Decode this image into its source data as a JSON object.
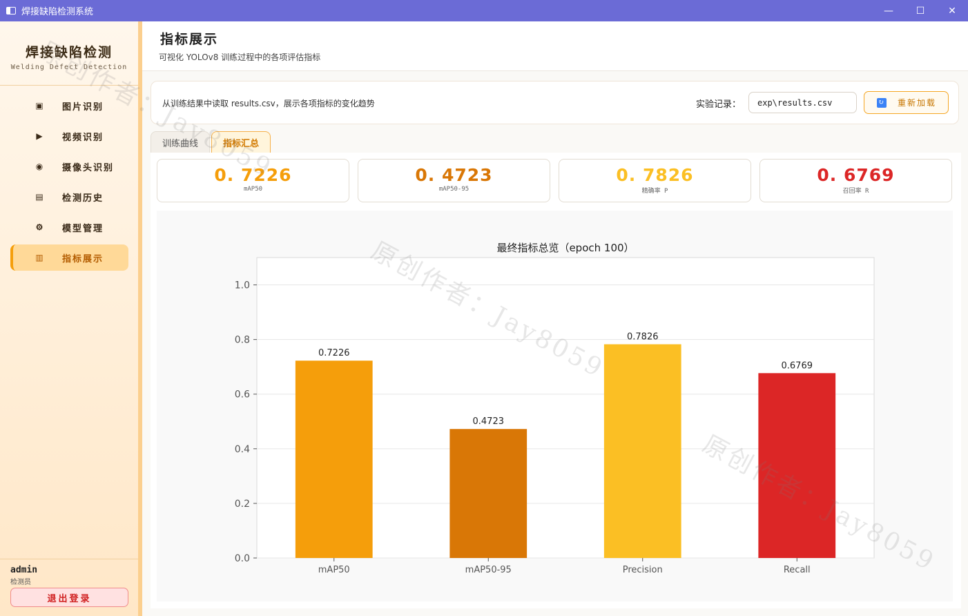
{
  "window": {
    "title": "焊接缺陷检测系统",
    "controls": {
      "minimize": "—",
      "maximize": "☐",
      "close": "✕"
    }
  },
  "sidebar": {
    "brand_title": "焊接缺陷检测",
    "brand_subtitle": "Welding Defect Detection",
    "items": [
      {
        "label": "图片识别",
        "icon": "image-icon",
        "glyph": "▣"
      },
      {
        "label": "视频识别",
        "icon": "video-icon",
        "glyph": "▶"
      },
      {
        "label": "摄像头识别",
        "icon": "camera-icon",
        "glyph": "◉"
      },
      {
        "label": "检测历史",
        "icon": "clipboard-icon",
        "glyph": "▤"
      },
      {
        "label": "模型管理",
        "icon": "gear-icon",
        "glyph": "⚙"
      },
      {
        "label": "指标展示",
        "icon": "bar-chart-icon",
        "glyph": "▥",
        "active": true
      }
    ],
    "user": {
      "name": "admin",
      "role": "检测员"
    },
    "logout_label": "退出登录"
  },
  "header": {
    "title": "指标展示",
    "subtitle": "可视化 YOLOv8 训练过程中的各项评估指标"
  },
  "toolbar": {
    "description": "从训练结果中读取 results.csv，展示各项指标的变化趋势",
    "experiment_label": "实验记录：",
    "experiment_value": "exp\\results.csv",
    "reload_label": "重新加载"
  },
  "tabs": [
    {
      "label": "训练曲线",
      "active": false
    },
    {
      "label": "指标汇总",
      "active": true
    }
  ],
  "cards": [
    {
      "value": "0. 7226",
      "label": "mAP50",
      "color": "#f59e0b"
    },
    {
      "value": "0. 4723",
      "label": "mAP50-95",
      "color": "#d97706"
    },
    {
      "value": "0. 7826",
      "label": "精确率 P",
      "color": "#fbbf24"
    },
    {
      "value": "0. 6769",
      "label": "召回率 R",
      "color": "#dc2626"
    }
  ],
  "watermark": "原创作者：Jay8059",
  "chart_data": {
    "type": "bar",
    "title": "最终指标总览（epoch 100）",
    "categories": [
      "mAP50",
      "mAP50-95",
      "Precision",
      "Recall"
    ],
    "values": [
      0.7226,
      0.4723,
      0.7826,
      0.6769
    ],
    "data_labels": [
      "0.7226",
      "0.4723",
      "0.7826",
      "0.6769"
    ],
    "colors": [
      "#f59e0b",
      "#d97706",
      "#fbbf24",
      "#dc2626"
    ],
    "ylim": [
      0,
      1.1
    ],
    "yticks": [
      0.0,
      0.2,
      0.4,
      0.6,
      0.8,
      1.0
    ],
    "ytick_labels": [
      "0.0",
      "0.2",
      "0.4",
      "0.6",
      "0.8",
      "1.0"
    ],
    "grid": true,
    "xlabel": "",
    "ylabel": ""
  }
}
